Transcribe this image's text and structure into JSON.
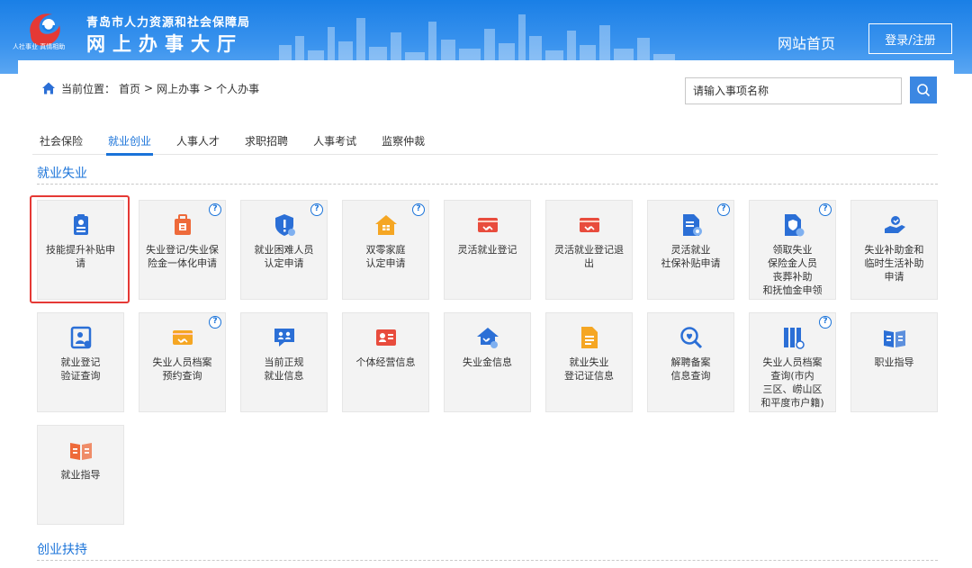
{
  "header": {
    "title_line1": "青岛市人力资源和社会保障局",
    "title_line2": "网上办事大厅",
    "logo_caption": "人社事业 真情相助",
    "home_link": "网站首页",
    "login_label": "登录/注册"
  },
  "breadcrumb": {
    "prefix": "当前位置：",
    "items": [
      "首页",
      ">",
      "网上办事",
      ">",
      "个人办事"
    ]
  },
  "search": {
    "placeholder": "请输入事项名称"
  },
  "tabs": [
    {
      "label": "社会保险",
      "active": false
    },
    {
      "label": "就业创业",
      "active": true
    },
    {
      "label": "人事人才",
      "active": false
    },
    {
      "label": "求职招聘",
      "active": false
    },
    {
      "label": "人事考试",
      "active": false
    },
    {
      "label": "监察仲裁",
      "active": false
    }
  ],
  "sections": [
    {
      "title": "就业失业"
    },
    {
      "title": "创业扶持"
    }
  ],
  "tiles": [
    {
      "label": "技能提升补贴申\n请",
      "icon": "clipboard-person-icon",
      "color": "#2b6fd6",
      "help": false
    },
    {
      "label": "失业登记/失业保\n险金一体化申请",
      "icon": "bag-document-icon",
      "color": "#ee6a3a",
      "help": true
    },
    {
      "label": "就业困难人员\n认定申请",
      "icon": "shield-alert-icon",
      "color": "#2b6fd6",
      "help": true
    },
    {
      "label": "双零家庭\n认定申请",
      "icon": "house-icon",
      "color": "#f5a623",
      "help": true
    },
    {
      "label": "灵活就业登记",
      "icon": "card-hands-icon",
      "color": "#e84c3d",
      "help": false
    },
    {
      "label": "灵活就业登记退\n出",
      "icon": "card-hands-icon",
      "color": "#e84c3d",
      "help": false
    },
    {
      "label": "灵活就业\n社保补贴申请",
      "icon": "document-gear-icon",
      "color": "#2b6fd6",
      "help": true
    },
    {
      "label": "领取失业\n保险金人员\n丧葬补助\n和抚恤金申领",
      "icon": "document-shield-icon",
      "color": "#2b6fd6",
      "help": true
    },
    {
      "label": "失业补助金和\n临时生活补助\n申请",
      "icon": "hand-coin-icon",
      "color": "#2b6fd6",
      "help": false
    },
    {
      "label": "就业登记\n验证查询",
      "icon": "frame-person-icon",
      "color": "#2b6fd6",
      "help": false
    },
    {
      "label": "失业人员档案\n预约查询",
      "icon": "card-hands-icon",
      "color": "#f5a623",
      "help": true
    },
    {
      "label": "当前正规\n就业信息",
      "icon": "chat-people-icon",
      "color": "#2b6fd6",
      "help": false
    },
    {
      "label": "个体经营信息",
      "icon": "id-card-icon",
      "color": "#e84c3d",
      "help": false
    },
    {
      "label": "失业金信息",
      "icon": "house-hands-icon",
      "color": "#2b6fd6",
      "help": false
    },
    {
      "label": "就业失业\n登记证信息",
      "icon": "document-lines-icon",
      "color": "#f5a623",
      "help": false
    },
    {
      "label": "解聘备案\n信息查询",
      "icon": "magnifier-heart-icon",
      "color": "#2b6fd6",
      "help": false
    },
    {
      "label": "失业人员档案\n查询(市内\n三区、崂山区\n和平度市户籍)",
      "icon": "binders-icon",
      "color": "#2b6fd6",
      "help": true
    },
    {
      "label": "职业指导",
      "icon": "book-chart-icon",
      "color": "#2b6fd6",
      "help": false
    },
    {
      "label": "就业指导",
      "icon": "book-chart-icon",
      "color": "#ee6a3a",
      "help": false
    }
  ]
}
